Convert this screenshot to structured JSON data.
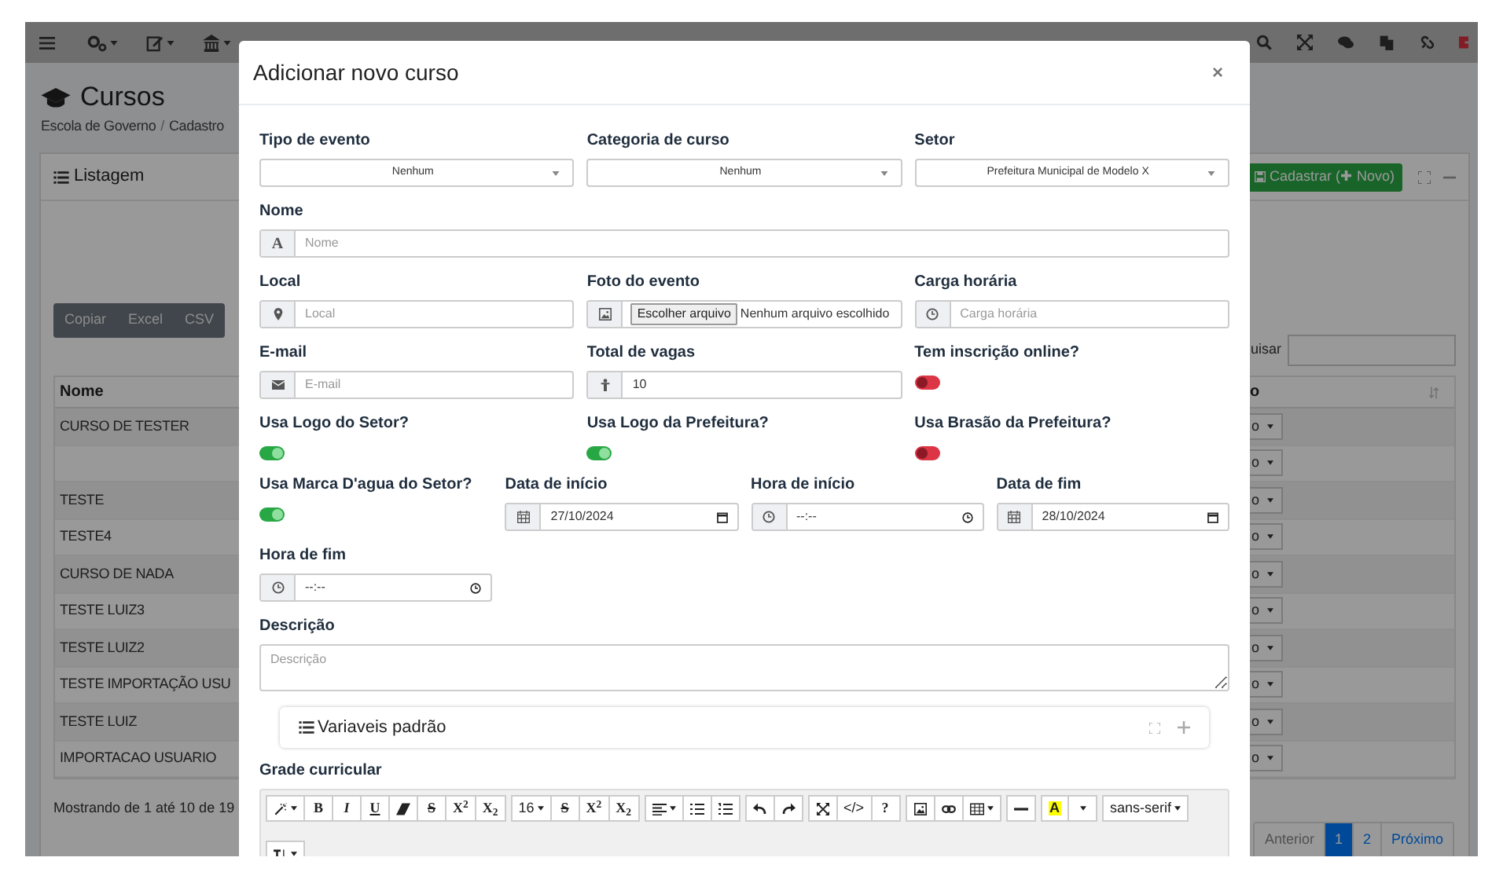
{
  "page": {
    "title": "Cursos",
    "breadcrumb": [
      "Escola de Governo",
      "Cadastro"
    ],
    "separator": "/"
  },
  "card": {
    "title": "Listagem",
    "new_button": "Cadastrar (✚ Novo)",
    "export_buttons": [
      "Copiar",
      "Excel",
      "CSV"
    ],
    "search_label": "uisar",
    "table": {
      "columns": [
        "Nome",
        "o"
      ],
      "rows": [
        {
          "name": "CURSO DE TESTER",
          "action": "o"
        },
        {
          "action": "o"
        },
        {
          "name": "TESTE",
          "action": "o"
        },
        {
          "name": "TESTE4",
          "action": "o"
        },
        {
          "name": "CURSO DE NADA",
          "action": "o"
        },
        {
          "name": "TESTE LUIZ3",
          "action": "o"
        },
        {
          "name": "TESTE LUIZ2",
          "action": "o"
        },
        {
          "name": "TESTE IMPORTAÇÃO USU",
          "action": "o"
        },
        {
          "name": "TESTE LUIZ",
          "action": "o"
        },
        {
          "name": "IMPORTACAO USUARIO",
          "action": "o"
        }
      ]
    },
    "footer": "Mostrando de 1 até 10 de 19",
    "pagination": [
      {
        "label": "Anterior",
        "selected": false,
        "disabled": true
      },
      {
        "label": "1",
        "selected": true,
        "disabled": false
      },
      {
        "label": "2",
        "selected": false,
        "disabled": false
      },
      {
        "label": "Próximo",
        "selected": false,
        "disabled": false
      }
    ]
  },
  "modal": {
    "title": "Adicionar novo curso",
    "close": "×",
    "rows": [
      [
        {
          "kind": "select",
          "label": "Tipo de evento",
          "value": "Nenhum"
        },
        {
          "kind": "select",
          "label": "Categoria de curso",
          "value": "Nenhum"
        },
        {
          "kind": "select",
          "label": "Setor",
          "value": "Prefeitura Municipal de Modelo X"
        }
      ],
      [
        {
          "kind": "text",
          "label": "Nome",
          "addon": "A",
          "placeholder": "Nome"
        }
      ],
      [
        {
          "kind": "text",
          "label": "Local",
          "placeholder": "Local"
        },
        {
          "kind": "file",
          "label": "Foto do evento",
          "button": "Escolher arquivo",
          "value": "Nenhum arquivo escolhido"
        },
        {
          "kind": "text",
          "label": "Carga horária",
          "placeholder": "Carga horária"
        }
      ],
      [
        {
          "kind": "text",
          "label": "E-mail",
          "placeholder": "E-mail"
        },
        {
          "kind": "text",
          "label": "Total de vagas",
          "value": "10"
        },
        {
          "kind": "toggle",
          "label": "Tem inscrição online?",
          "on": false
        }
      ],
      [
        {
          "kind": "toggle",
          "label": "Usa Logo do Setor?",
          "on": true
        },
        {
          "kind": "toggle",
          "label": "Usa Logo da Prefeitura?",
          "on": true
        },
        {
          "kind": "toggle",
          "label": "Usa Brasão da Prefeitura?",
          "on": false
        }
      ],
      [
        {
          "kind": "toggle",
          "label": "Usa Marca D'agua do Setor?",
          "on": true
        },
        {
          "kind": "date",
          "label": "Data de início",
          "value": "27/10/2024"
        },
        {
          "kind": "time",
          "label": "Hora de início",
          "value": "--:--"
        },
        {
          "kind": "date",
          "label": "Data de fim",
          "value": "28/10/2024"
        }
      ],
      [
        {
          "kind": "time",
          "label": "Hora de fim",
          "value": "--:--"
        }
      ],
      [
        {
          "kind": "textarea",
          "label": "Descrição",
          "placeholder": "Descrição"
        }
      ]
    ],
    "panel": {
      "title": "Variaveis padrão"
    },
    "editor": {
      "label": "Grade curricular",
      "toolbar": [
        [
          {
            "kind": "wand",
            "caret": true
          },
          {
            "kind": "bold",
            "text": "B"
          },
          {
            "kind": "italic",
            "text": "I"
          },
          {
            "kind": "underline",
            "text": "U"
          },
          {
            "kind": "eraser"
          },
          {
            "kind": "strike",
            "text": "S"
          },
          {
            "kind": "bold",
            "text": "X$^{2}$"
          },
          {
            "kind": "bold",
            "text": "X$_{2}$"
          }
        ],
        [
          {
            "kind": "text",
            "text": "16",
            "caret": true
          },
          {
            "kind": "strike",
            "text": "S"
          },
          {
            "kind": "bold",
            "text": "X$^{2}$"
          },
          {
            "kind": "bold",
            "text": "X$_{2}$"
          }
        ],
        [
          {
            "kind": "align",
            "caret": true
          },
          {
            "kind": "ul"
          },
          {
            "kind": "ol"
          }
        ],
        [
          {
            "kind": "undo"
          },
          {
            "kind": "redo"
          }
        ],
        [
          {
            "kind": "fullscreen"
          },
          {
            "kind": "text",
            "text": "</>"
          },
          {
            "kind": "bold",
            "text": "?"
          }
        ],
        [
          {
            "kind": "image"
          },
          {
            "kind": "link"
          },
          {
            "kind": "table",
            "caret": true
          }
        ],
        [
          {
            "kind": "hr"
          }
        ],
        [
          {
            "kind": "highlight",
            "text": "A"
          },
          {
            "kind": "menu",
            "caret": true
          }
        ],
        [
          {
            "kind": "text",
            "text": "sans-serif",
            "caret": true
          }
        ],
        [
          {
            "kind": "height",
            "caret": true
          }
        ]
      ]
    }
  }
}
